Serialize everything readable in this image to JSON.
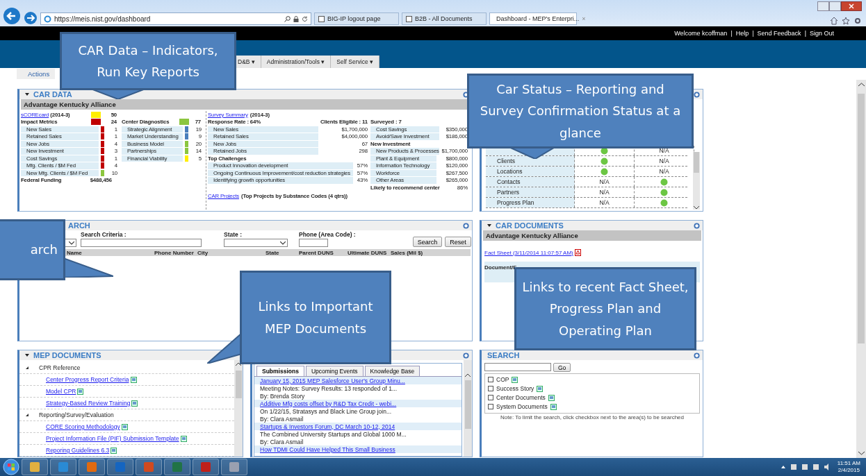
{
  "browser": {
    "url": "https://meis.nist.gov/dashboard",
    "tabs": [
      {
        "title": "BIG-IP logout page",
        "selected": false
      },
      {
        "title": "B2B - All Documents",
        "selected": false
      },
      {
        "title": "Dashboard - MEP's Enterpri...",
        "selected": true
      }
    ],
    "close": "×"
  },
  "header": {
    "links": [
      "Welcome kcoffman",
      "Help",
      "Send Feedback",
      "Sign Out"
    ],
    "separator": "|"
  },
  "nav": {
    "menus": [
      "D&B ▾",
      "Administration/Tools ▾",
      "Self Service ▾"
    ]
  },
  "actions": "Actions",
  "car_data": {
    "title": "CAR DATA",
    "org": "Advantage Kentucky Alliance",
    "scorecard": {
      "link": "sCOREcard",
      "period": "(2014-3)",
      "color": "#ffee00",
      "value": "50"
    },
    "impact": {
      "label": "Impact Metrics",
      "color": "#c00000",
      "value": "24",
      "rows": [
        {
          "label": "New Sales",
          "color": "#c00000",
          "value": "1"
        },
        {
          "label": "Retained Sales",
          "color": "#c00000",
          "value": "1"
        },
        {
          "label": "New Jobs",
          "color": "#c00000",
          "value": "4"
        },
        {
          "label": "New Investment",
          "color": "#c00000",
          "value": "3"
        },
        {
          "label": "Cost Savings",
          "color": "#c00000",
          "value": "1"
        },
        {
          "label": "Mfg. Clients / $M Fed",
          "color": "#c00000",
          "value": "4"
        },
        {
          "label": "New Mfg. Clients / $M Fed",
          "color": "#8cc63f",
          "value": "10"
        }
      ]
    },
    "federal": {
      "label": "Federal Funding",
      "value": "$488,456"
    },
    "diagnostics": {
      "label": "Center Diagnostics",
      "color": "#8cc63f",
      "value": "77",
      "rows": [
        {
          "label": "Strategic Alignment",
          "color": "#4a7ebb",
          "value": "19"
        },
        {
          "label": "Market Understanding",
          "color": "#4a7ebb",
          "value": "9"
        },
        {
          "label": "Business Model",
          "color": "#8cc63f",
          "value": "20"
        },
        {
          "label": "Partnerships",
          "color": "#8cc63f",
          "value": "14"
        },
        {
          "label": "Financial Viability",
          "color": "#ffee00",
          "value": "5"
        }
      ]
    },
    "survey": {
      "link": "Survey Summary",
      "period": "(2014-3)",
      "response": "Response Rate :  64%",
      "eligible": "Clients Eligible :  11",
      "surveyed": "Surveyed :  7",
      "metrics": [
        {
          "label": "New Sales",
          "value": "$1,700,000"
        },
        {
          "label": "Retained Sales",
          "value": "$4,000,000"
        },
        {
          "label": "New Jobs",
          "value": "67"
        },
        {
          "label": "Retained Jobs",
          "value": "298"
        }
      ],
      "challenges_title": "Top Challenges",
      "challenges": [
        {
          "label": "Product Innovation development",
          "value": "57%"
        },
        {
          "label": "Ongoing Continuous Improvement/cost reduction strategies",
          "value": "57%"
        },
        {
          "label": "Identifying growth opportunities",
          "value": "43%"
        }
      ],
      "savings": [
        {
          "label": "Cost Savings",
          "value": "$350,000"
        },
        {
          "label": "Avoid/Save Investment",
          "value": "$186,000"
        }
      ],
      "investment_title": "New Investment",
      "investments": [
        {
          "label": "New Products & Processes",
          "value": "$1,700,000"
        },
        {
          "label": "Plant & Equipment",
          "value": "$800,000"
        },
        {
          "label": "Information Technology",
          "value": "$120,000"
        },
        {
          "label": "Workforce",
          "value": "$267,500"
        },
        {
          "label": "Other Areas",
          "value": "$265,000"
        }
      ],
      "recommend": {
        "label": "Likely to recommend center",
        "value": "86%"
      },
      "projects_link": "CAR Projects",
      "projects_note": "(Top Projects by Substance Codes (4 qtrs))"
    }
  },
  "car_status": {
    "rows": [
      {
        "cells": [
          {
            "kind": "dot"
          },
          {
            "kind": "text",
            "text": "N/A"
          }
        ]
      },
      {
        "label": "Clients",
        "cells": [
          {
            "kind": "dot"
          },
          {
            "kind": "text",
            "text": "N/A"
          }
        ]
      },
      {
        "label": "Locations",
        "cells": [
          {
            "kind": "dot"
          },
          {
            "kind": "text",
            "text": "N/A"
          }
        ]
      },
      {
        "label": "Contacts",
        "cells": [
          {
            "kind": "text",
            "text": "N/A"
          },
          {
            "kind": "dot"
          }
        ]
      },
      {
        "label": "Partners",
        "cells": [
          {
            "kind": "text",
            "text": "N/A"
          },
          {
            "kind": "dot"
          }
        ]
      },
      {
        "label": "Progress Plan",
        "cells": [
          {
            "kind": "text",
            "text": "N/A"
          },
          {
            "kind": "dot"
          }
        ]
      }
    ]
  },
  "client_search": {
    "title": "ARCH",
    "criteria_label": "Search Criteria :",
    "state_label": "State :",
    "phone_label": "Phone (Area Code) :",
    "buttons": [
      "Search",
      "Reset"
    ],
    "columns": [
      "Name",
      "Phone Number",
      "City",
      "State",
      "Parent DUNS",
      "Ultimate DUNS",
      "Sales (Mil $)"
    ]
  },
  "car_documents": {
    "title": "CAR DOCUMENTS",
    "org": "Advantage Kentucky Alliance",
    "link": "Fact Sheet (3/11/2014 11:07:57 AM)",
    "column_1": "Document/F"
  },
  "mep_documents": {
    "title": "MEP DOCUMENTS",
    "tree": [
      {
        "label": "CPR Reference",
        "expanded": true,
        "children": [
          {
            "label": "Center Progress Report Criteria"
          },
          {
            "label": "Model CPR"
          },
          {
            "label": "Strategy-Based Review Training"
          }
        ]
      },
      {
        "label": "Reporting/Survey/Evaluation",
        "expanded": true,
        "children": [
          {
            "label": "CORE Scoring Methodology"
          },
          {
            "label": "Project Information File (PIF) Submission Template"
          },
          {
            "label": "Reporing Guidelines 6.3"
          }
        ]
      }
    ]
  },
  "news": {
    "tabs": [
      {
        "label": "Submissions",
        "selected": true
      },
      {
        "label": "Upcoming Events",
        "selected": false
      },
      {
        "label": "Knowledge Base",
        "selected": false
      }
    ],
    "items": [
      {
        "link": "January 15, 2015 MEP Salesforce User's Group Minu...",
        "text": "Meeting Notes: Survey Results: 13 responded of 1...",
        "by": "By: Brenda Story"
      },
      {
        "link": "Additive Mfg costs offset by R&D Tax Credit - webi...",
        "text": "On 1/22/15, Stratasys and Black Line Group join...",
        "by": "By: Clara Asmail"
      },
      {
        "link": "Startups & Investors Forum, DC March 10-12, 2014",
        "text": "The Combined University Startups and Global 1000 M...",
        "by": "By: Clara Asmail"
      },
      {
        "link": "How TDMI Could Have Helped This Small Business"
      }
    ]
  },
  "doc_search": {
    "title": "SEARCH",
    "button": "Go",
    "options": [
      {
        "label": "COP",
        "checked": false
      },
      {
        "label": "Success Story",
        "checked": false
      },
      {
        "label": "Center Documents",
        "checked": false
      },
      {
        "label": "System Documents",
        "checked": false
      }
    ],
    "note": "Note: To limit the search, click checkbox next to the area(s) to be searched"
  },
  "taskbar": {
    "time": "11:51 AM",
    "date": "2/4/2015"
  },
  "callouts": [
    {
      "text": "CAR Data – Indicators, Run Key Reports"
    },
    {
      "text": "Car Status – Reporting and Survey Confirmation Status at a glance"
    },
    {
      "text": "arch"
    },
    {
      "text": "Links to Important MEP Documents"
    },
    {
      "text": "Links to recent Fact Sheet, Progress Plan and Operating Plan"
    }
  ]
}
